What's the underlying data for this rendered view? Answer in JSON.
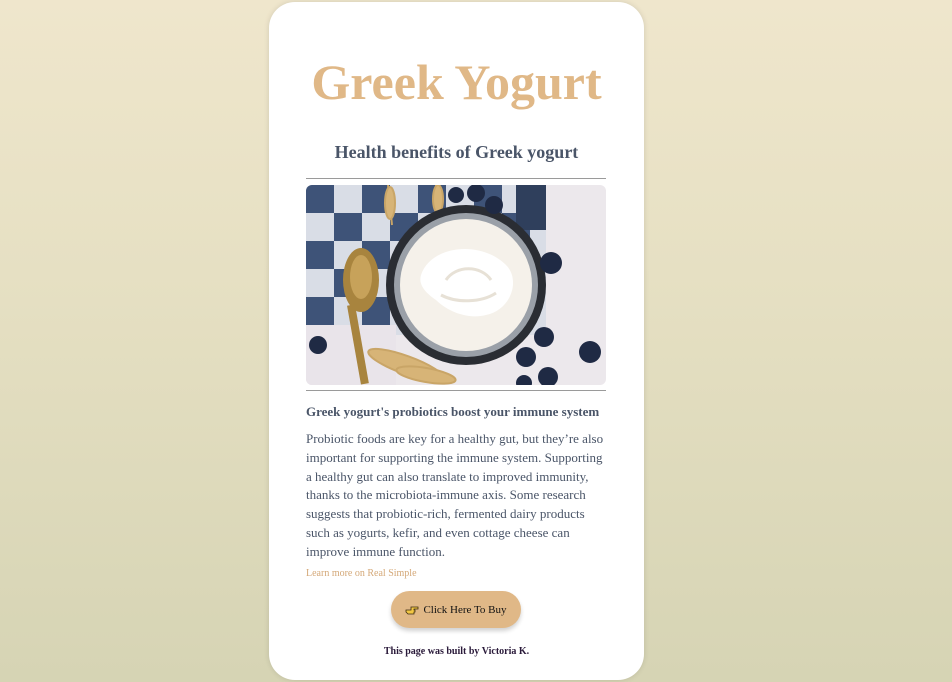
{
  "page": {
    "title": "Greek Yogurt",
    "subtitle": "Health benefits of Greek yogurt",
    "image_alt": "Bowl of Greek yogurt with blueberries, spoon and wheat on a checkered cloth"
  },
  "section": {
    "heading": "Greek yogurt's probiotics boost your immune system",
    "body": "Probiotic foods are key for a healthy gut, but they’re also important for supporting the immune system. Supporting a healthy gut can also translate to improved immunity, thanks to the microbiota-immune axis. Some research suggests that probiotic-rich, fermented dairy products such as yogurts, kefir, and even cottage cheese can improve immune function.",
    "link_label": "Learn more on Real Simple"
  },
  "cta": {
    "label": "Click Here To Buy",
    "icon": "pointing-hand-icon"
  },
  "footer": {
    "text": "This page was built by Victoria K."
  },
  "colors": {
    "accent": "#e0b887",
    "heading_text": "#4a5568",
    "link": "#d4a878",
    "background_top": "#efe6cc",
    "background_bottom": "#d6d4b4",
    "card": "#ffffff"
  }
}
